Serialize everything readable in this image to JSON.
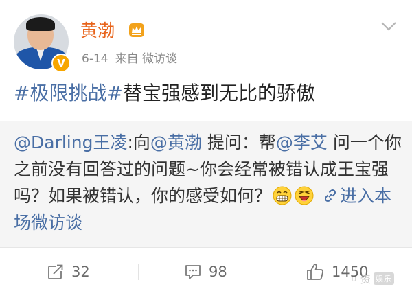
{
  "post": {
    "author": {
      "name": "黄渤",
      "verified_badge": "V"
    },
    "meta": {
      "date": "6-14",
      "source": "来自 微访谈"
    },
    "text": {
      "tag1": "#极限挑战#",
      "body": "替宝强感到无比的骄傲"
    },
    "repost": {
      "author_mention": "@Darling王凌",
      "seg1": ":向",
      "mention2": "@黄渤",
      "seg2": " 提问：帮",
      "mention3": "@李艾",
      "seg3": " 问一个你之前没有回答过的问题~你会经常被错认成王宝强吗？如果被错认，你的感受如何？",
      "emoji1": "grin-emoji",
      "emoji2": "laugh-emoji",
      "link_text": "进入本场微访谈"
    },
    "actions": {
      "repost_count": "32",
      "comment_count": "98",
      "like_count": "1450"
    },
    "watermark": {
      "text": "ㄸ资",
      "badge": "娱乐"
    },
    "colors": {
      "username": "#e8641b",
      "link": "#4a6fa5",
      "repost_bg": "#f5f5f5",
      "verified": "#f7a600"
    }
  }
}
